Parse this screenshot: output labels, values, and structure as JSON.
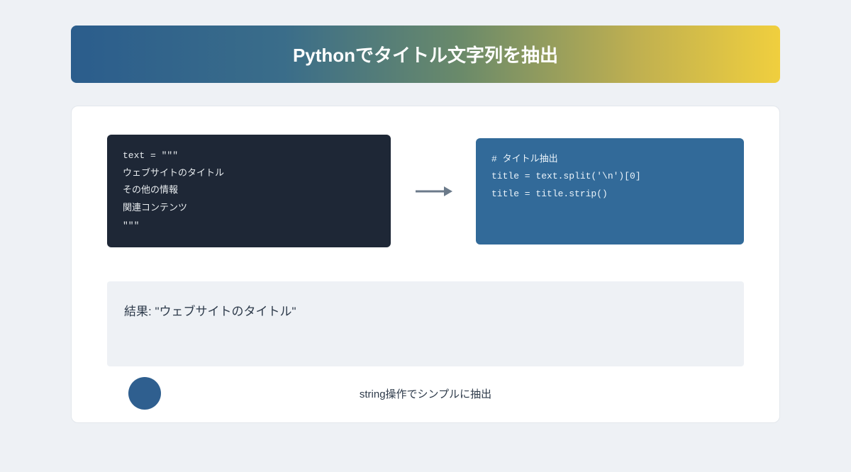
{
  "header": {
    "title": "Pythonでタイトル文字列を抽出"
  },
  "code_left": "text = \"\"\"\nウェブサイトのタイトル\nその他の情報\n関連コンテンツ\n\"\"\"",
  "code_right": "# タイトル抽出\ntitle = text.split('\\n')[0]\ntitle = title.strip()",
  "result": "結果: \"ウェブサイトのタイトル\"",
  "footer": "string操作でシンプルに抽出"
}
